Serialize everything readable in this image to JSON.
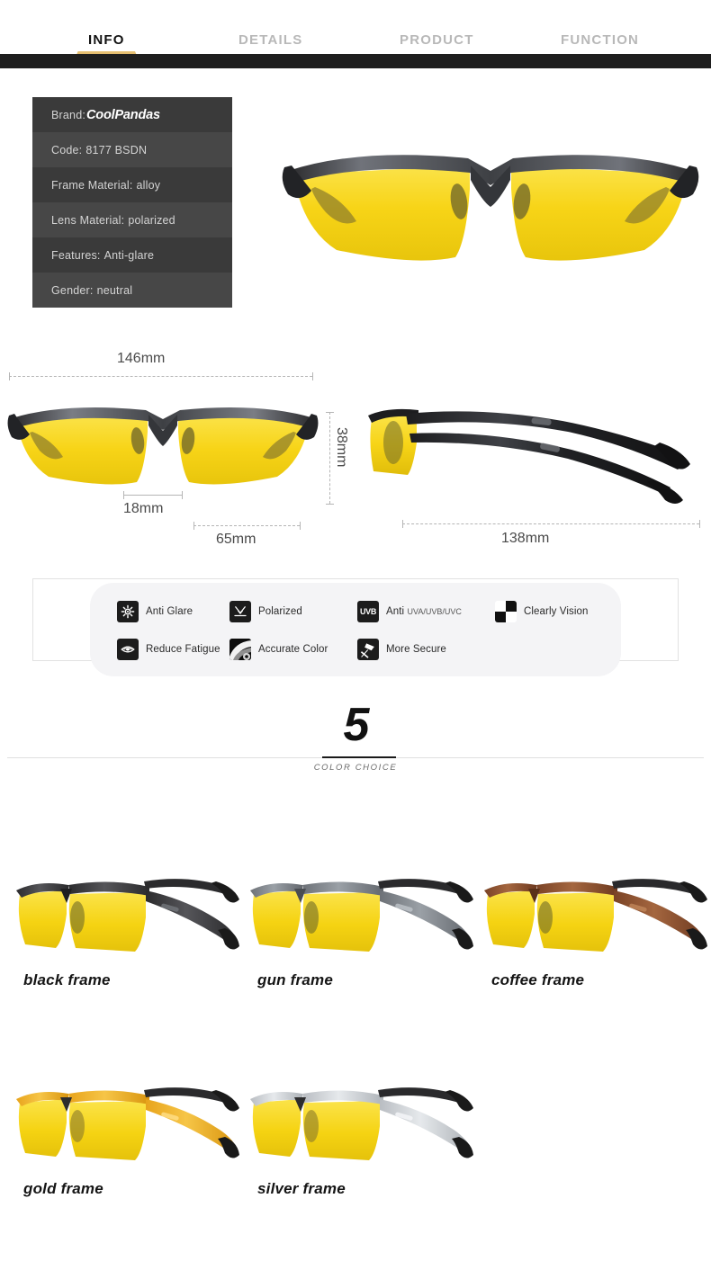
{
  "nav": {
    "tabs": [
      {
        "label": "INFO",
        "active": true
      },
      {
        "label": "DETAILS",
        "active": false
      },
      {
        "label": "PRODUCT",
        "active": false
      },
      {
        "label": "FUNCTION",
        "active": false
      }
    ]
  },
  "spec": {
    "rows": [
      {
        "label": "Brand:",
        "value": "CoolPandas",
        "brand": true
      },
      {
        "label": "Code:",
        "value": "8177 BSDN"
      },
      {
        "label": "Frame Material:",
        "value": "alloy"
      },
      {
        "label": "Lens Material:",
        "value": "polarized"
      },
      {
        "label": "Features:",
        "value": "Anti-glare"
      },
      {
        "label": "Gender:",
        "value": "neutral"
      }
    ]
  },
  "dimensions": {
    "front_width": "146mm",
    "front_height": "38mm",
    "bridge": "18mm",
    "lens_width": "65mm",
    "temple_length": "138mm"
  },
  "features": [
    {
      "label": "Anti Glare",
      "icon": "sun-burst-icon",
      "sublabel": ""
    },
    {
      "label": "Polarized",
      "icon": "arrow-down-polarize-icon",
      "sublabel": ""
    },
    {
      "label": "Anti ",
      "icon": "uvb-badge-icon",
      "sublabel": "UVA/UVB/UVC",
      "badge": "UVB"
    },
    {
      "label": "Clearly Vision",
      "icon": "checkerboard-icon",
      "sublabel": ""
    },
    {
      "label": "Reduce Fatigue",
      "icon": "eye-icon",
      "sublabel": ""
    },
    {
      "label": "Accurate Color",
      "icon": "color-gradient-icon",
      "sublabel": ""
    },
    {
      "label": "More Secure",
      "icon": "hammer-icon",
      "sublabel": ""
    }
  ],
  "color_choice": {
    "count": "5",
    "caption": "COLOR CHOICE"
  },
  "variants": [
    {
      "label": "black frame",
      "frame_color": "#2b2b2d",
      "frame_color_2": "#555559",
      "tip_color": "#1a1a1a"
    },
    {
      "label": "gun frame",
      "frame_color": "#6d7177",
      "frame_color_2": "#9aa0a6",
      "tip_color": "#1a1a1a"
    },
    {
      "label": "coffee frame",
      "frame_color": "#7a4326",
      "frame_color_2": "#a4663f",
      "tip_color": "#1a1a1a"
    },
    {
      "label": "gold frame",
      "frame_color": "#e8a41c",
      "frame_color_2": "#f6c547",
      "tip_color": "#1a1a1a"
    },
    {
      "label": "silver frame",
      "frame_color": "#b9bdc2",
      "frame_color_2": "#e6e9ec",
      "tip_color": "#1a1a1a"
    }
  ],
  "colors": {
    "lens_yellow": "#f5d312",
    "accent_gold": "#d9ab55",
    "dark_bar": "#1e1e1e",
    "spec_row_odd": "#3a3a3a",
    "spec_row_even": "#474747"
  }
}
